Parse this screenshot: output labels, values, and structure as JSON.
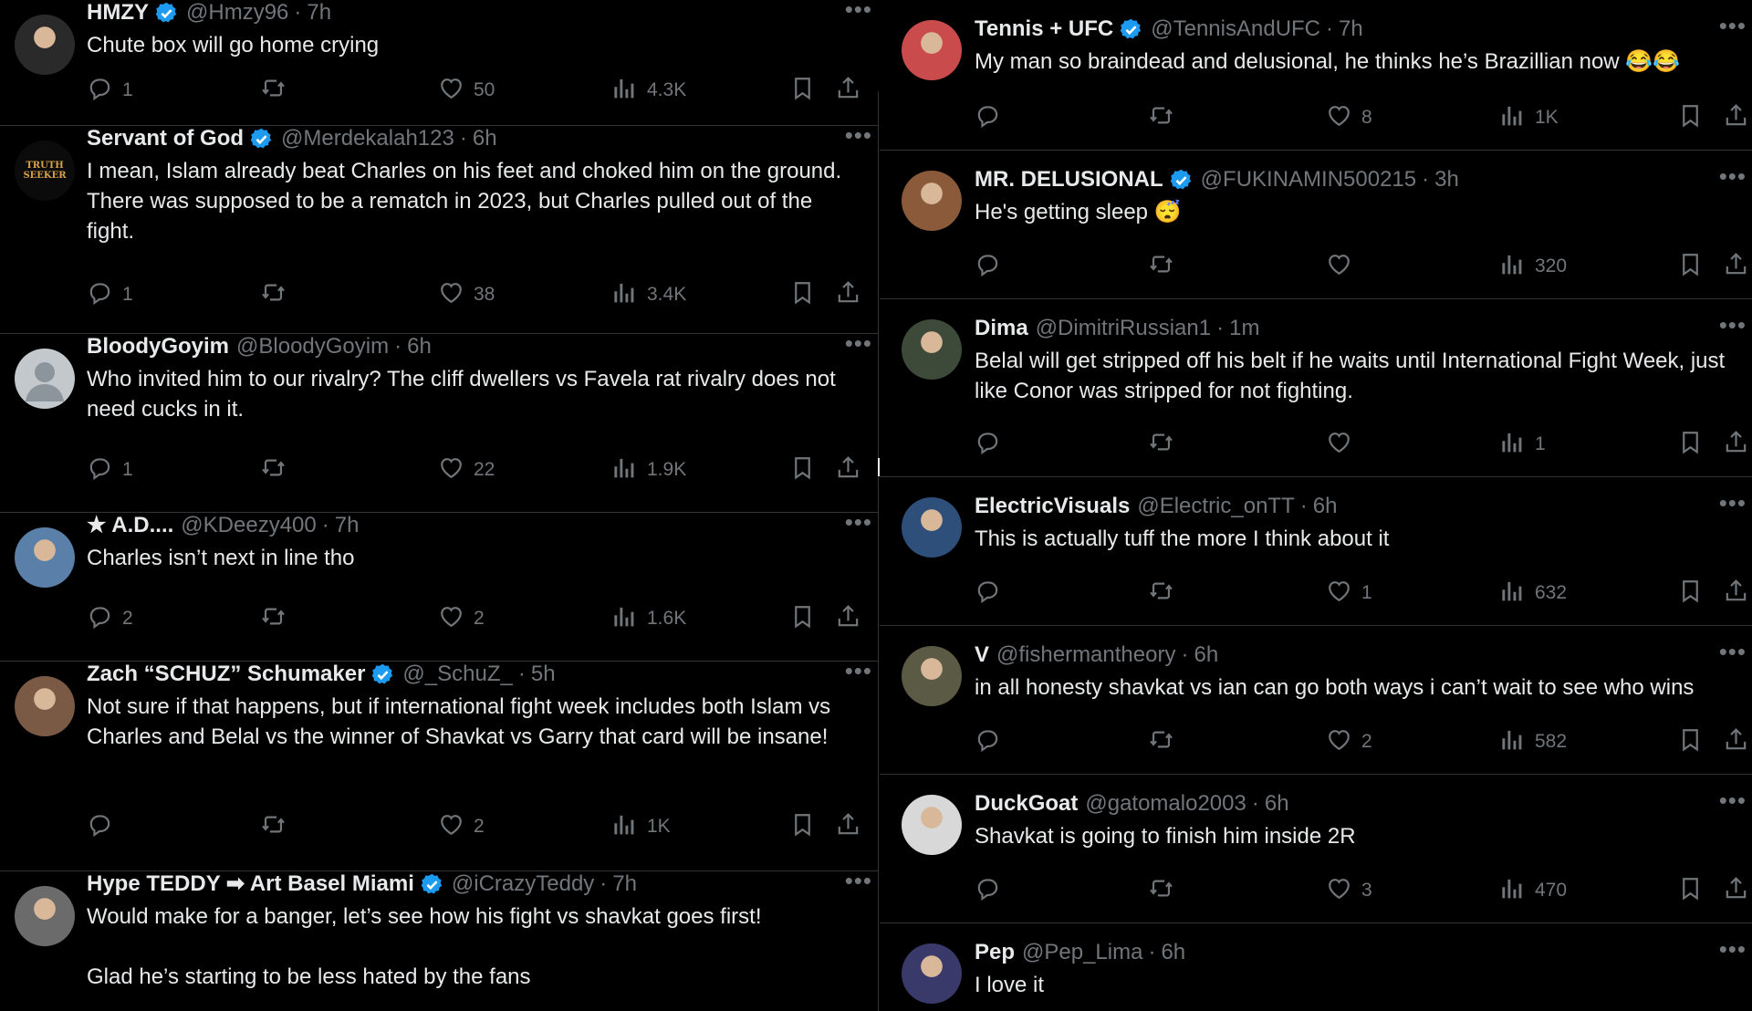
{
  "colors": {
    "bg": "#000000",
    "text": "#e7e9ea",
    "muted": "#71767b",
    "border": "#2f3336",
    "verified": "#1d9bf0"
  },
  "left": [
    {
      "name": "HMZY",
      "verified": true,
      "handle": "@Hmzy96",
      "time": "7h",
      "text": "Chute box will go home crying",
      "replies": "1",
      "reposts": "",
      "likes": "50",
      "views": "4.3K",
      "avatar": "avatar-dark"
    },
    {
      "name": "Servant of God",
      "verified": true,
      "handle": "@Merdekalah123",
      "time": "6h",
      "text": "I mean, Islam already beat Charles on his feet and choked him on the ground. There was supposed to be a rematch in 2023, but Charles pulled out of the fight.",
      "replies": "1",
      "reposts": "",
      "likes": "38",
      "views": "3.4K",
      "avatar_text": "TRUTH SEEKER"
    },
    {
      "name": "BloodyGoyim",
      "verified": false,
      "handle": "@BloodyGoyim",
      "time": "6h",
      "text": "Who invited him to our rivalry? The cliff dwellers vs Favela rat rivalry does not need cucks in it.",
      "replies": "1",
      "reposts": "",
      "likes": "22",
      "views": "1.9K",
      "avatar": "default"
    },
    {
      "name": "★ A.D....",
      "verified": false,
      "handle": "@KDeezy400",
      "time": "7h",
      "text": "Charles isn’t next in line tho",
      "replies": "2",
      "reposts": "",
      "likes": "2",
      "views": "1.6K",
      "avatar": "photo"
    },
    {
      "name": "Zach “SCHUZ” Schumaker",
      "verified": true,
      "handle": "@_SchuZ_",
      "time": "5h",
      "text": "Not sure if that happens, but if international fight week includes both Islam vs Charles and Belal vs the winner of Shavkat vs Garry that card will be insane!",
      "replies": "",
      "reposts": "",
      "likes": "2",
      "views": "1K",
      "avatar": "photo"
    },
    {
      "name": "Hype TEDDY ➡ Art Basel Miami",
      "verified": true,
      "handle": "@iCrazyTeddy",
      "time": "7h",
      "text": "Would make for a banger, let’s see how his fight vs shavkat goes first!\n\nGlad he’s starting to be less hated by the fans",
      "replies": "",
      "reposts": "",
      "likes": "",
      "views": "",
      "avatar": "photo"
    }
  ],
  "right": [
    {
      "name": "Tennis + UFC",
      "verified": true,
      "handle": "@TennisAndUFC",
      "time": "7h",
      "text": "My man so braindead and delusional, he thinks he’s Brazillian now",
      "emoji": "😂😂",
      "replies": "",
      "reposts": "",
      "likes": "8",
      "views": "1K"
    },
    {
      "name": "MR. DELUSIONAL",
      "verified": true,
      "handle": "@FUKINAMIN500215",
      "time": "3h",
      "text": "He's getting sleep",
      "emoji": "😴",
      "replies": "",
      "reposts": "",
      "likes": "",
      "views": "320"
    },
    {
      "name": "Dima",
      "verified": false,
      "handle": "@DimitriRussian1",
      "time": "1m",
      "text": "Belal will get stripped off his belt if he waits until International Fight Week, just like Conor was stripped for not fighting.",
      "replies": "",
      "reposts": "",
      "likes": "",
      "views": "1"
    },
    {
      "name": "ElectricVisuals",
      "verified": false,
      "handle": "@Electric_onTT",
      "time": "6h",
      "text": "This is actually tuff the more I think about it",
      "replies": "",
      "reposts": "",
      "likes": "1",
      "views": "632"
    },
    {
      "name": "V",
      "verified": false,
      "handle": "@fishermantheory",
      "time": "6h",
      "text": "in all honesty shavkat vs ian can go both ways i can’t wait to see who wins",
      "replies": "",
      "reposts": "",
      "likes": "2",
      "views": "582"
    },
    {
      "name": "DuckGoat",
      "verified": false,
      "handle": "@gatomalo2003",
      "time": "6h",
      "text": "Shavkat is going to finish him inside 2R",
      "replies": "",
      "reposts": "",
      "likes": "3",
      "views": "470"
    },
    {
      "name": "Pep",
      "verified": false,
      "handle": "@Pep_Lima",
      "time": "6h",
      "text": "I love it",
      "replies": "",
      "reposts": "",
      "likes": "",
      "views": ""
    }
  ]
}
